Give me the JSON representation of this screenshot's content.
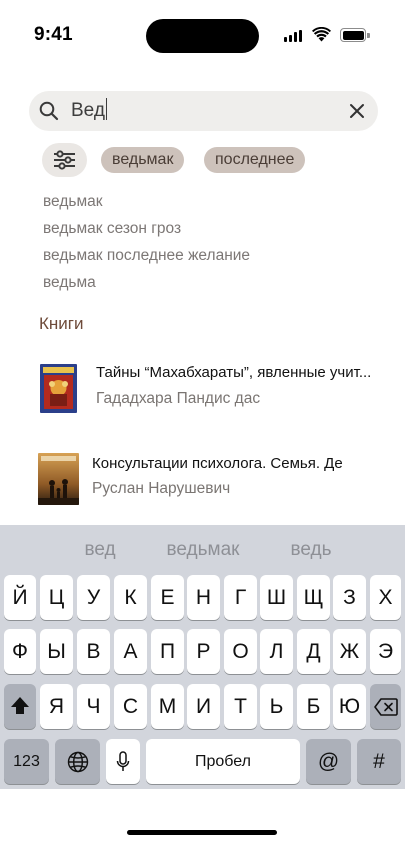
{
  "status_bar": {
    "time": "9:41"
  },
  "search": {
    "query": "Вед",
    "icon": "search-icon",
    "clear_icon": "close-icon"
  },
  "filter": {
    "icon": "sliders-icon"
  },
  "chips": [
    {
      "label": "ведьмак"
    },
    {
      "label": "последнее"
    }
  ],
  "suggestions": [
    "ведьмак",
    "ведьмак сезон гроз",
    "ведьмак последнее желание",
    "ведьма"
  ],
  "books_section": {
    "title": "Книги",
    "items": [
      {
        "title": "Тайны “Махабхараты”, явленные учит...",
        "author": "Гададхара Пандис дас"
      },
      {
        "title": "Консультации психолога. Семья. Де",
        "author": "Руслан Нарушевич"
      }
    ]
  },
  "colors": {
    "accent": "#6e4b3a",
    "chip_bg": "#cdc2bb",
    "search_bg": "#efeeec",
    "keyboard_bg": "#d2d5dc"
  },
  "keyboard": {
    "predictions": [
      "вед",
      "ведьмак",
      "ведь"
    ],
    "row1": [
      "Й",
      "Ц",
      "У",
      "К",
      "Е",
      "Н",
      "Г",
      "Ш",
      "Щ",
      "З",
      "Х"
    ],
    "row2": [
      "Ф",
      "Ы",
      "В",
      "А",
      "П",
      "Р",
      "О",
      "Л",
      "Д",
      "Ж",
      "Э"
    ],
    "row3": [
      "Я",
      "Ч",
      "С",
      "М",
      "И",
      "Т",
      "Ь",
      "Б",
      "Ю"
    ],
    "numbers_label": "123",
    "space_label": "Пробел",
    "at_label": "@",
    "hash_label": "#",
    "shift_icon": "shift-icon",
    "delete_icon": "backspace-icon",
    "globe_icon": "globe-icon",
    "mic_icon": "microphone-icon"
  }
}
